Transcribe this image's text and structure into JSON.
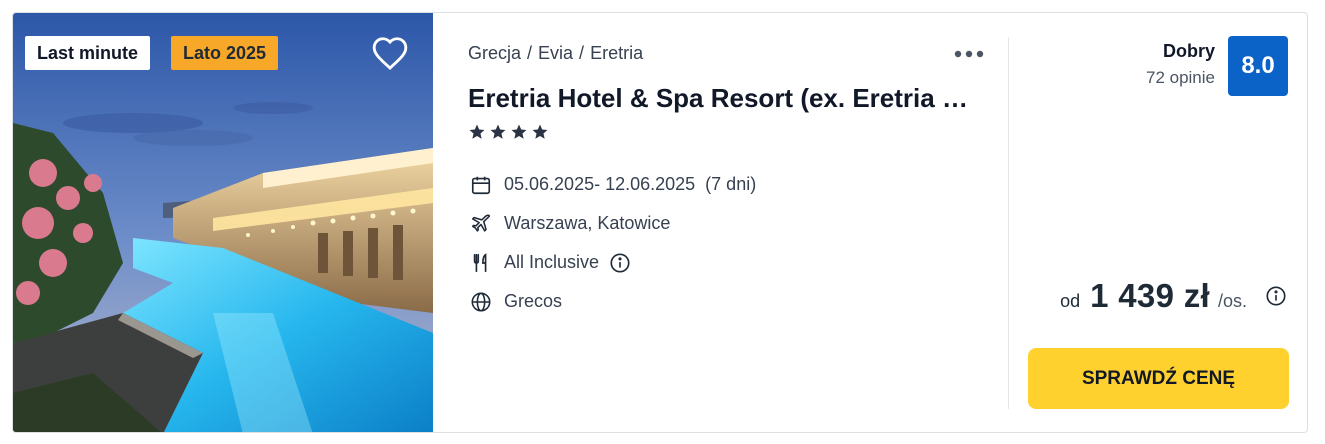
{
  "badges": {
    "last_minute": "Last minute",
    "season": "Lato 2025"
  },
  "breadcrumb": {
    "country": "Grecja",
    "region": "Evia",
    "city": "Eretria",
    "separator": "/"
  },
  "hotel": {
    "name": "Eretria Hotel & Spa Resort (ex. Eretria Hotel & Spa Resort)",
    "stars": 4
  },
  "trip": {
    "dates": "05.06.2025- 12.06.2025",
    "duration": "(7 dni)",
    "departure": "Warszawa, Katowice",
    "board": "All Inclusive",
    "operator": "Grecos"
  },
  "rating": {
    "label": "Dobry",
    "reviews": "72 opinie",
    "score": "8.0"
  },
  "price": {
    "prefix": "od",
    "amount": "1 439 zł",
    "suffix": "/os."
  },
  "cta": {
    "label": "SPRAWDŹ CENĘ"
  },
  "colors": {
    "accent_blue": "#0b63c8",
    "cta_yellow": "#ffd12f",
    "badge_orange": "#f7a828"
  },
  "icons": [
    "heart-icon",
    "more-icon",
    "star-icon",
    "calendar-icon",
    "plane-icon",
    "restaurant-icon",
    "info-icon",
    "globe-icon"
  ]
}
